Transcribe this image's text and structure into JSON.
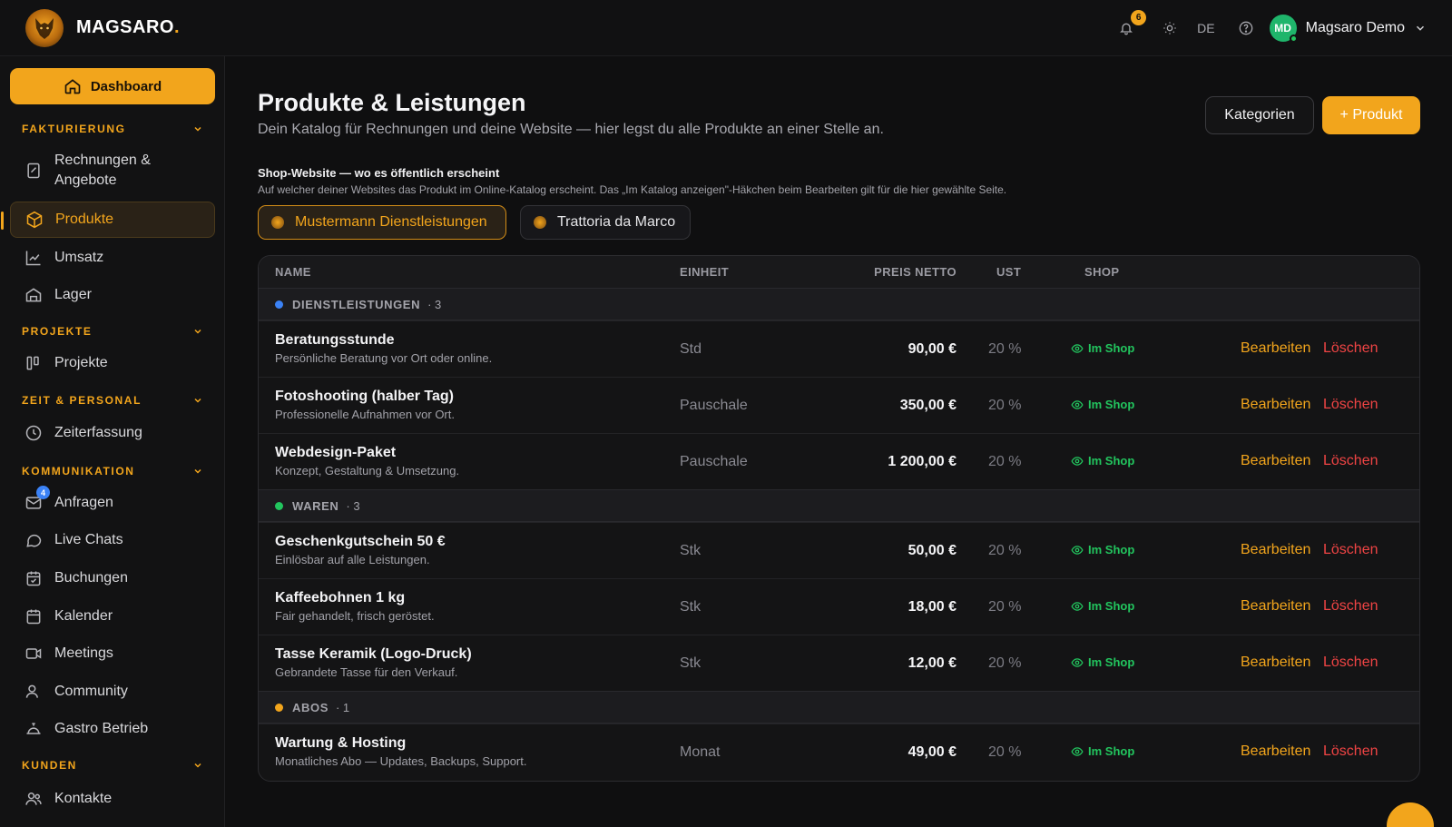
{
  "brand": {
    "name": "MAGSARO",
    "dot": "."
  },
  "topbar": {
    "notifications": "6",
    "language": "DE",
    "user_initials": "MD",
    "user_name": "Magsaro Demo"
  },
  "sidebar": {
    "dashboard": "Dashboard",
    "sections": [
      {
        "label": "FAKTURIERUNG"
      },
      {
        "label": "PROJEKTE"
      },
      {
        "label": "ZEIT & PERSONAL"
      },
      {
        "label": "KOMMUNIKATION"
      },
      {
        "label": "KUNDEN"
      }
    ],
    "items": [
      {
        "label": "Rechnungen &",
        "label2": "Angebote"
      },
      {
        "label": "Produkte"
      },
      {
        "label": "Umsatz"
      },
      {
        "label": "Lager"
      },
      {
        "label": "Projekte"
      },
      {
        "label": "Zeiterfassung"
      },
      {
        "label": "Anfragen",
        "badge": "4"
      },
      {
        "label": "Live Chats"
      },
      {
        "label": "Buchungen"
      },
      {
        "label": "Kalender"
      },
      {
        "label": "Meetings"
      },
      {
        "label": "Community"
      },
      {
        "label": "Gastro Betrieb"
      },
      {
        "label": "Kontakte"
      }
    ]
  },
  "page": {
    "title": "Produkte & Leistungen",
    "subtitle": "Dein Katalog für Rechnungen und deine Website — hier legst du alle Produkte an einer Stelle an.",
    "btn_categories": "Kategorien",
    "btn_add": "+ Produkt"
  },
  "shop": {
    "title": "Shop-Website — wo es öffentlich erscheint",
    "subtitle": "Auf welcher deiner Websites das Produkt im Online-Katalog erscheint. Das „Im Katalog anzeigen\"-Häkchen beim Bearbeiten gilt für die hier gewählte Seite.",
    "sites": [
      "Mustermann Dienstleistungen",
      "Trattoria da Marco"
    ]
  },
  "table": {
    "headers": {
      "name": "NAME",
      "unit": "EINHEIT",
      "price": "PREIS NETTO",
      "vat": "UST",
      "shop": "SHOP"
    },
    "shop_label": "Im Shop",
    "edit": "Bearbeiten",
    "delete": "Löschen",
    "groups": [
      {
        "label": "DIENSTLEISTUNGEN",
        "count": "· 3",
        "color": "#3b82f6"
      },
      {
        "label": "WAREN",
        "count": "· 3",
        "color": "#22c55e"
      },
      {
        "label": "ABOS",
        "count": "· 1",
        "color": "#f2a51c"
      }
    ],
    "rows": [
      {
        "name": "Beratungsstunde",
        "desc": "Persönliche Beratung vor Ort oder online.",
        "unit": "Std",
        "price": "90,00 €",
        "vat": "20 %"
      },
      {
        "name": "Fotoshooting (halber Tag)",
        "desc": "Professionelle Aufnahmen vor Ort.",
        "unit": "Pauschale",
        "price": "350,00 €",
        "vat": "20 %"
      },
      {
        "name": "Webdesign-Paket",
        "desc": "Konzept, Gestaltung & Umsetzung.",
        "unit": "Pauschale",
        "price": "1 200,00 €",
        "vat": "20 %"
      },
      {
        "name": "Geschenkgutschein 50 €",
        "desc": "Einlösbar auf alle Leistungen.",
        "unit": "Stk",
        "price": "50,00 €",
        "vat": "20 %"
      },
      {
        "name": "Kaffeebohnen 1 kg",
        "desc": "Fair gehandelt, frisch geröstet.",
        "unit": "Stk",
        "price": "18,00 €",
        "vat": "20 %"
      },
      {
        "name": "Tasse Keramik (Logo-Druck)",
        "desc": "Gebrandete Tasse für den Verkauf.",
        "unit": "Stk",
        "price": "12,00 €",
        "vat": "20 %"
      },
      {
        "name": "Wartung & Hosting",
        "desc": "Monatliches Abo — Updates, Backups, Support.",
        "unit": "Monat",
        "price": "49,00 €",
        "vat": "20 %"
      }
    ]
  }
}
